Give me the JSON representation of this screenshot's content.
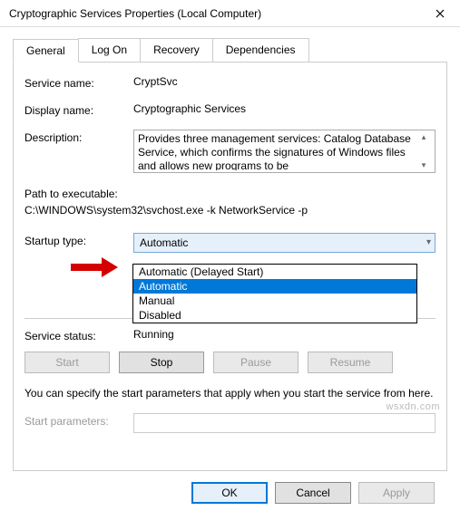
{
  "window": {
    "title": "Cryptographic Services Properties (Local Computer)"
  },
  "tabs": {
    "general": "General",
    "logon": "Log On",
    "recovery": "Recovery",
    "dependencies": "Dependencies"
  },
  "general": {
    "service_name_label": "Service name:",
    "service_name_value": "CryptSvc",
    "display_name_label": "Display name:",
    "display_name_value": "Cryptographic Services",
    "description_label": "Description:",
    "description_value": "Provides three management services: Catalog Database Service, which confirms the signatures of Windows files and allows new programs to be",
    "path_label": "Path to executable:",
    "path_value": "C:\\WINDOWS\\system32\\svchost.exe -k NetworkService -p",
    "startup_type_label": "Startup type:",
    "startup_type_selected": "Automatic",
    "dropdown_options": {
      "delayed": "Automatic (Delayed Start)",
      "automatic": "Automatic",
      "manual": "Manual",
      "disabled": "Disabled"
    },
    "service_status_label": "Service status:",
    "service_status_value": "Running",
    "buttons": {
      "start": "Start",
      "stop": "Stop",
      "pause": "Pause",
      "resume": "Resume"
    },
    "hint": "You can specify the start parameters that apply when you start the service from here.",
    "start_params_label": "Start parameters:"
  },
  "footer": {
    "ok": "OK",
    "cancel": "Cancel",
    "apply": "Apply"
  },
  "watermark": "wsxdn.com"
}
